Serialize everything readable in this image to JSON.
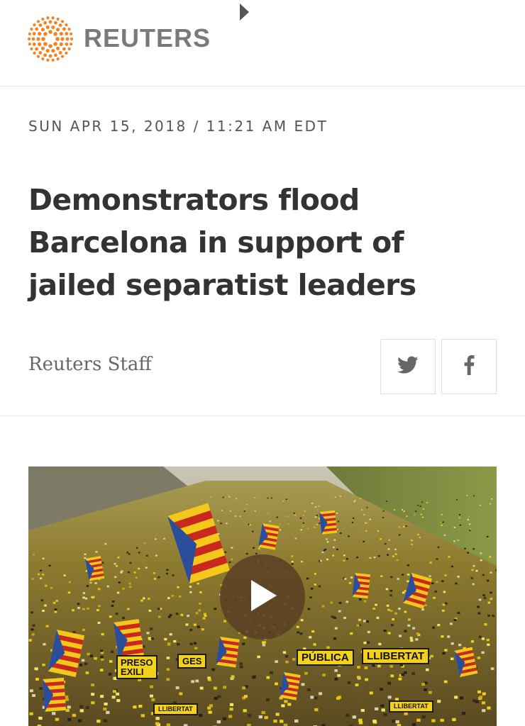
{
  "header": {
    "brand_name": "REUTERS",
    "logo_icon": "reuters-dot-ring-icon",
    "nav_icon": "triangle-right-icon",
    "brand_color": "#f58220"
  },
  "article": {
    "dateline": "SUN APR 15, 2018 / 11:21 AM EDT",
    "headline": "Demonstrators flood Barcelona in support of jailed separatist leaders",
    "byline": "Reuters Staff"
  },
  "share": {
    "twitter_icon": "twitter-bird-icon",
    "facebook_icon": "facebook-f-icon"
  },
  "video": {
    "play_icon": "play-icon",
    "banners": [
      "PÚBLICA",
      "LLIBERTAT",
      "PRESO\nEXILI",
      "GES",
      "LLIBERTAT",
      "LLIBERTAT"
    ]
  }
}
